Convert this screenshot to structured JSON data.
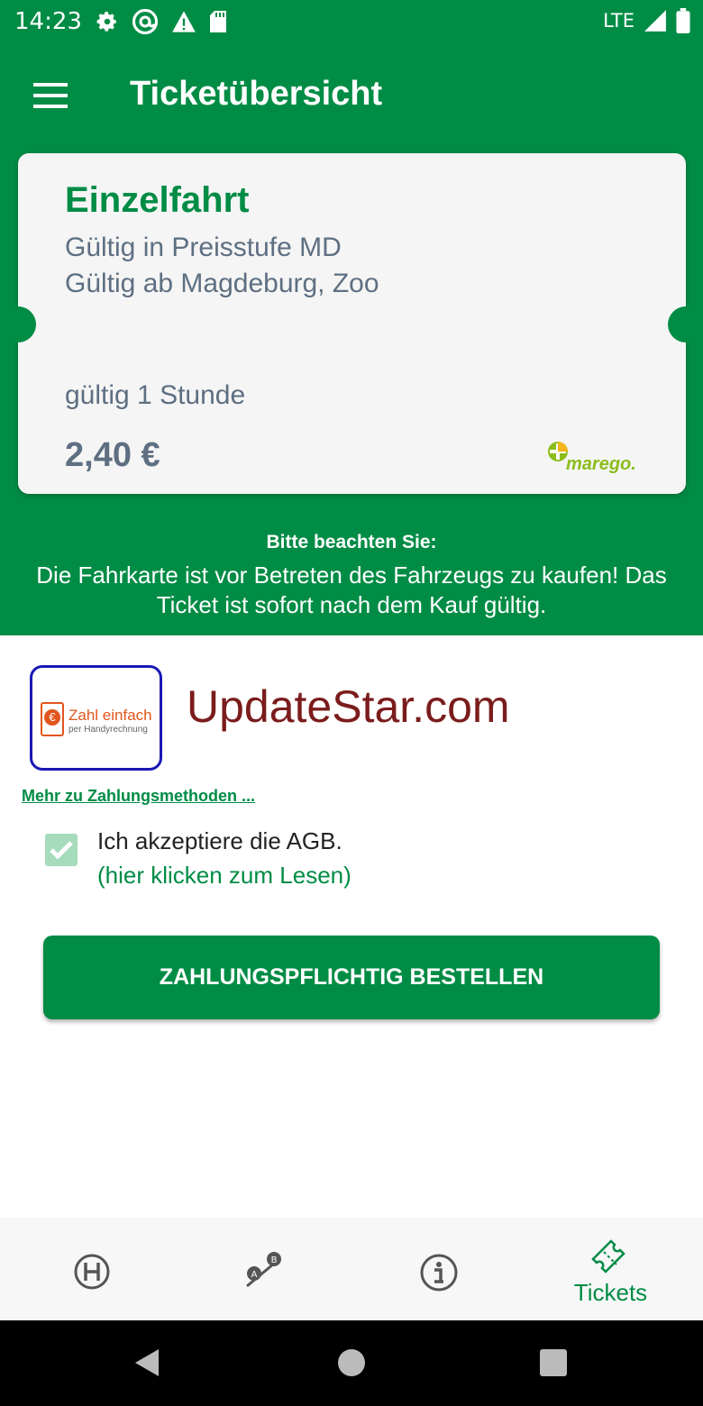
{
  "status_bar": {
    "time": "14:23",
    "network": "LTE",
    "icons_left": [
      "gear-icon",
      "at-sign-icon",
      "warning-icon",
      "sd-card-icon"
    ],
    "icons_right": [
      "signal-icon",
      "battery-icon"
    ]
  },
  "app_bar": {
    "title": "Ticketübersicht",
    "menu_icon": "hamburger-menu-icon"
  },
  "ticket": {
    "name": "Einzelfahrt",
    "validity_zone": "Gültig in Preisstufe MD",
    "validity_start": "Gültig ab Magdeburg, Zoo",
    "duration": "gültig 1 Stunde",
    "price": "2,40 €",
    "brand": "marego."
  },
  "notice": {
    "title": "Bitte beachten Sie:",
    "text": "Die Fahrkarte ist vor Betreten des Fahrzeugs zu kaufen! Das Ticket ist sofort nach dem Kauf gültig."
  },
  "payment": {
    "method_title": "Zahl einfach",
    "method_subtitle": "per Handyrechnung",
    "watermark": "UpdateStar.com",
    "more_link": "Mehr zu Zahlungsmethoden ..."
  },
  "agb": {
    "checked": true,
    "label": "Ich akzeptiere die AGB.",
    "link": "(hier klicken zum Lesen)"
  },
  "order_button": {
    "label": "ZAHLUNGSPFLICHTIG BESTELLEN"
  },
  "bottom_nav": {
    "items": [
      {
        "icon": "stop-h-icon",
        "label": ""
      },
      {
        "icon": "route-ab-icon",
        "label": ""
      },
      {
        "icon": "info-icon",
        "label": ""
      },
      {
        "icon": "ticket-icon",
        "label": "Tickets",
        "active": true
      }
    ]
  },
  "colors": {
    "primary": "#008c45",
    "text_muted": "#5e6f82",
    "checkbox": "#a6dbbc",
    "watermark": "#7b1c1c",
    "payment_border": "#1a18b4",
    "payment_accent": "#e2551e"
  }
}
